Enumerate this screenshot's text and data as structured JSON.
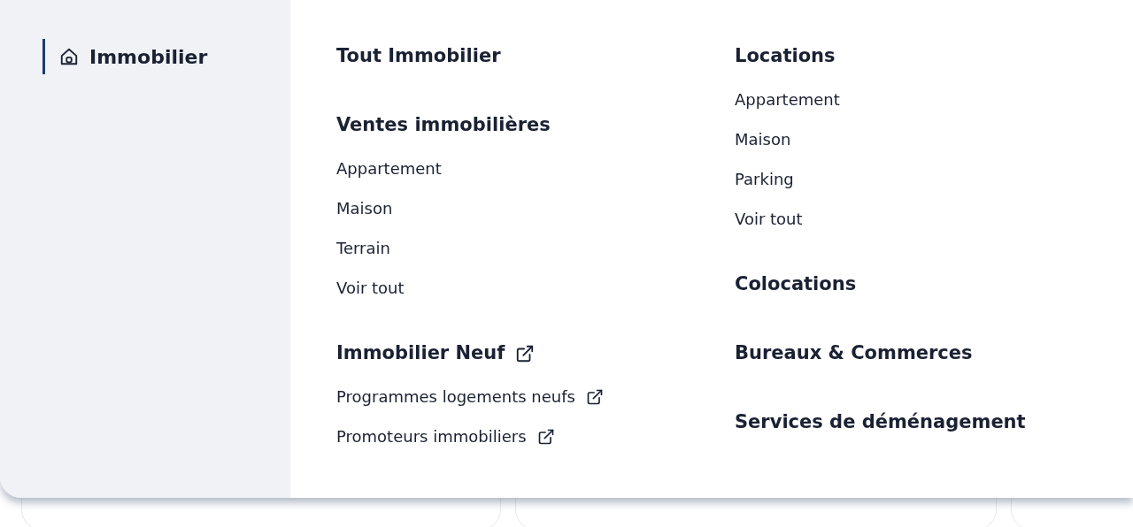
{
  "sidebar": {
    "items": [
      {
        "label": "Immobilier",
        "selected": true
      }
    ]
  },
  "columns": [
    [
      {
        "heading": "Tout Immobilier",
        "external": false
      },
      {
        "heading": "Ventes immobilières",
        "external": false,
        "links": [
          {
            "label": "Appartement",
            "external": false
          },
          {
            "label": "Maison",
            "external": false
          },
          {
            "label": "Terrain",
            "external": false
          },
          {
            "label": "Voir tout",
            "external": false
          }
        ]
      },
      {
        "heading": "Immobilier Neuf",
        "external": true,
        "links": [
          {
            "label": "Programmes logements neufs",
            "external": true
          },
          {
            "label": "Promoteurs immobiliers",
            "external": true
          }
        ]
      }
    ],
    [
      {
        "heading": "Locations",
        "external": false,
        "links": [
          {
            "label": "Appartement",
            "external": false
          },
          {
            "label": "Maison",
            "external": false
          },
          {
            "label": "Parking",
            "external": false
          },
          {
            "label": "Voir tout",
            "external": false
          }
        ]
      },
      {
        "heading": "Colocations",
        "external": false
      },
      {
        "heading": "Bureaux & Commerces",
        "external": false
      },
      {
        "heading": "Services de déménagement",
        "external": false
      }
    ]
  ]
}
